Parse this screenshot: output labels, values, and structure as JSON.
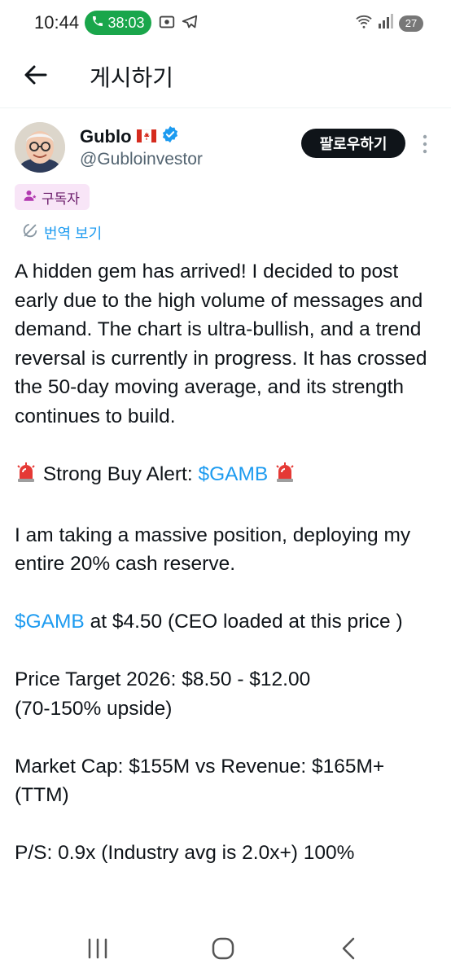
{
  "status_bar": {
    "time": "10:44",
    "call_duration": "38:03",
    "battery_level": "27",
    "icons": [
      "phone-icon",
      "screen-record-icon",
      "telegram-icon",
      "wifi-icon",
      "signal-icon",
      "battery-icon"
    ]
  },
  "header": {
    "back_icon": "arrow-left-icon",
    "title": "게시하기"
  },
  "author": {
    "name": "Gublo",
    "flag": "🇨🇦",
    "handle": "@Gubloinvestor",
    "verified_color": "#1d9bf0"
  },
  "follow_button": {
    "label": "팔로우하기"
  },
  "subscriber_badge": {
    "label": "구독자"
  },
  "translate": {
    "label": "번역 보기"
  },
  "post": {
    "para1": "A hidden gem has arrived! I decided to post early due to the high volume of messages and demand. The chart is ultra-bullish, and a trend reversal is currently in progress. It has crossed the 50-day moving average, and its strength continues to build.",
    "alert_prefix": "Strong Buy Alert: ",
    "alert_cashtag": "$GAMB",
    "para3": "I am taking a massive position, deploying my entire 20% cash reserve.",
    "price_cashtag": "$GAMB",
    "price_text": " at $4.50 (CEO loaded at this price )",
    "target_line1": "Price Target 2026: $8.50 - $12.00",
    "target_line2": "(70-150% upside)",
    "market_line1": "Market Cap: $155M vs Revenue: $165M+",
    "market_line2": "(TTM)",
    "ps_line": "P/S: 0.9x (Industry avg is 2.0x+) 100%"
  },
  "colors": {
    "accent": "#1d9bf0",
    "text": "#0f1419",
    "secondary": "#536471",
    "follow_bg": "#0f1419",
    "call_green": "#1aa64b",
    "badge_bg": "#f8e5f7"
  },
  "nav_bar": {
    "icons": [
      "recent-apps-icon",
      "home-icon",
      "back-icon"
    ]
  }
}
